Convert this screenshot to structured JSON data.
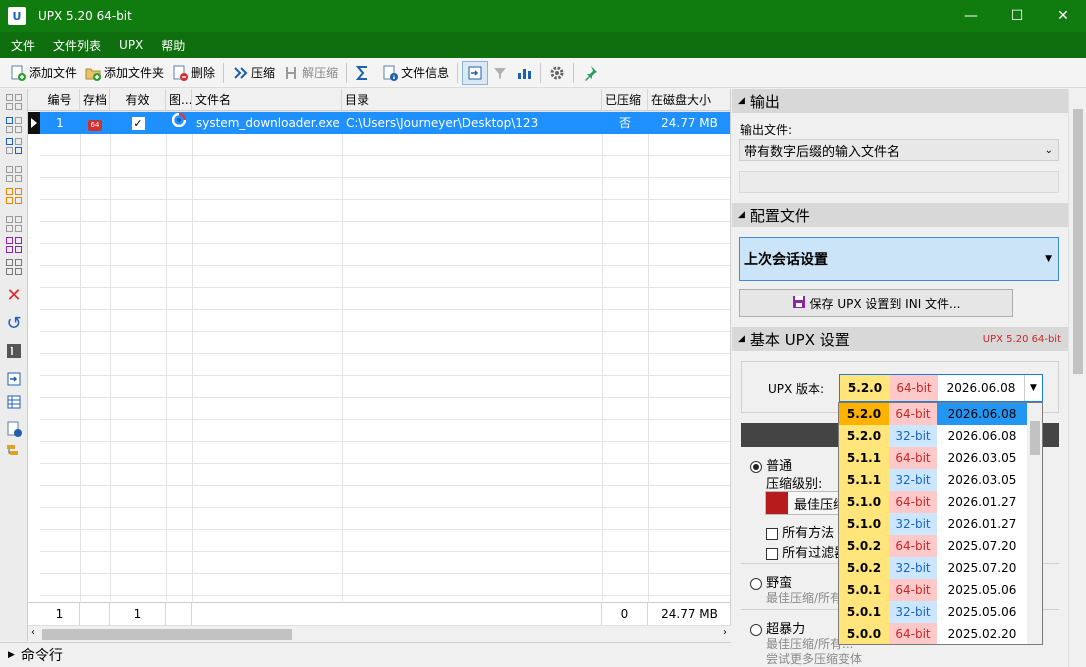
{
  "window": {
    "logo": "U",
    "title": "UPX 5.20 64-bit",
    "minimize": "—",
    "maximize": "☐",
    "close": "✕"
  },
  "menu": [
    "文件",
    "文件列表",
    "UPX",
    "帮助"
  ],
  "toolbar": {
    "add_file": "添加文件",
    "add_folder": "添加文件夹",
    "delete": "删除",
    "compress": "压缩",
    "decompress": "解压缩",
    "file_info": "文件信息"
  },
  "grid": {
    "columns": [
      "编号",
      "存档",
      "有效",
      "图...",
      "文件名",
      "目录",
      "已压缩",
      "在磁盘大小"
    ],
    "rows": [
      {
        "index": "1",
        "archive_badge": "64",
        "valid": "✓",
        "filename": "system_downloader.exe",
        "directory": "C:\\Users\\Journeyer\\Desktop\\123",
        "compressed": "否",
        "size": "24.77 MB"
      }
    ],
    "footer": {
      "count": "1",
      "valid_count": "1",
      "compressed_count": "0",
      "total_size": "24.77 MB"
    }
  },
  "command_line": "命令行",
  "output": {
    "header": "输出",
    "file_label": "输出文件:",
    "file_value": "带有数字后缀的输入文件名"
  },
  "config": {
    "header": "配置文件",
    "profile": "上次会话设置",
    "save_button": "保存 UPX 设置到 INI 文件..."
  },
  "basic": {
    "header": "基本 UPX 设置",
    "version_tag": "UPX 5.20 64-bit",
    "version_label": "UPX 版本:",
    "selected": {
      "version": "5.2.0",
      "bits": "64-bit",
      "date": "2026.06.08"
    },
    "versions": [
      {
        "version": "5.2.0",
        "bits": "64-bit",
        "date": "2026.06.08"
      },
      {
        "version": "5.2.0",
        "bits": "32-bit",
        "date": "2026.06.08"
      },
      {
        "version": "5.1.1",
        "bits": "64-bit",
        "date": "2026.03.05"
      },
      {
        "version": "5.1.1",
        "bits": "32-bit",
        "date": "2026.03.05"
      },
      {
        "version": "5.1.0",
        "bits": "64-bit",
        "date": "2026.01.27"
      },
      {
        "version": "5.1.0",
        "bits": "32-bit",
        "date": "2026.01.27"
      },
      {
        "version": "5.0.2",
        "bits": "64-bit",
        "date": "2025.07.20"
      },
      {
        "version": "5.0.2",
        "bits": "32-bit",
        "date": "2025.07.20"
      },
      {
        "version": "5.0.1",
        "bits": "64-bit",
        "date": "2025.05.06"
      },
      {
        "version": "5.0.1",
        "bits": "32-bit",
        "date": "2025.05.06"
      },
      {
        "version": "5.0.0",
        "bits": "64-bit",
        "date": "2025.02.20"
      }
    ],
    "normal": "普通",
    "level_label": "压缩级别:",
    "level_value": "最佳压缩",
    "all_methods": "所有方法",
    "all_filters": "所有过滤器",
    "brute": "野蛮",
    "brute_desc": "最佳压缩/所有...",
    "ultra": "超暴力",
    "ultra_desc1": "最佳压缩/所有...",
    "ultra_desc2": "尝试更多压缩变体"
  }
}
